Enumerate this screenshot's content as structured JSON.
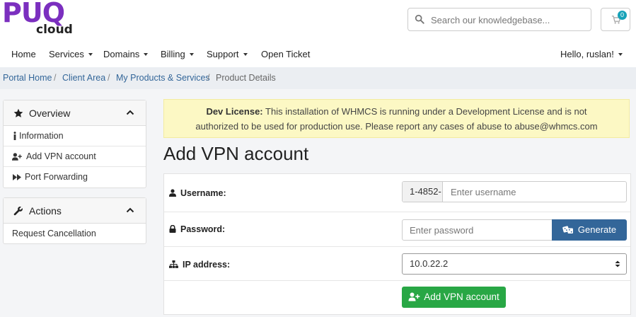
{
  "logo": {
    "line1": "PUQ",
    "line2": "cloud"
  },
  "search": {
    "placeholder": "Search our knowledgebase..."
  },
  "cart": {
    "count": "0"
  },
  "nav": {
    "home": "Home",
    "services": "Services",
    "domains": "Domains",
    "billing": "Billing",
    "support": "Support",
    "open_ticket": "Open Ticket",
    "user": "Hello, ruslan!"
  },
  "breadcrumb": {
    "portal_home": "Portal Home",
    "client_area": "Client Area",
    "products": "My Products & Services",
    "current": "Product Details",
    "separator": "/"
  },
  "sidebar": {
    "overview": {
      "title": "Overview",
      "items": [
        {
          "label": "Information"
        },
        {
          "label": "Add VPN account"
        },
        {
          "label": "Port Forwarding"
        }
      ]
    },
    "actions": {
      "title": "Actions",
      "items": [
        {
          "label": "Request Cancellation"
        }
      ]
    }
  },
  "alert": {
    "strong": "Dev License:",
    "line1": "This installation of WHMCS is running under a Development License and is not",
    "line2": "authorized to be used for production use. Please report any cases of abuse to abuse@whmcs.com"
  },
  "page": {
    "title": "Add VPN account"
  },
  "form": {
    "username": {
      "label": "Username:",
      "prefix": "1-4852-",
      "placeholder": "Enter username"
    },
    "password": {
      "label": "Password:",
      "placeholder": "Enter password",
      "generate": "Generate"
    },
    "ip": {
      "label": "IP address:",
      "selected": "10.0.22.2"
    },
    "submit": "Add VPN account"
  },
  "colors": {
    "brand": "#7b2fbf",
    "link": "#336699",
    "primary": "#336699",
    "success": "#28a745",
    "badge": "#17a2b8",
    "alert_bg": "#fcf8c4"
  }
}
